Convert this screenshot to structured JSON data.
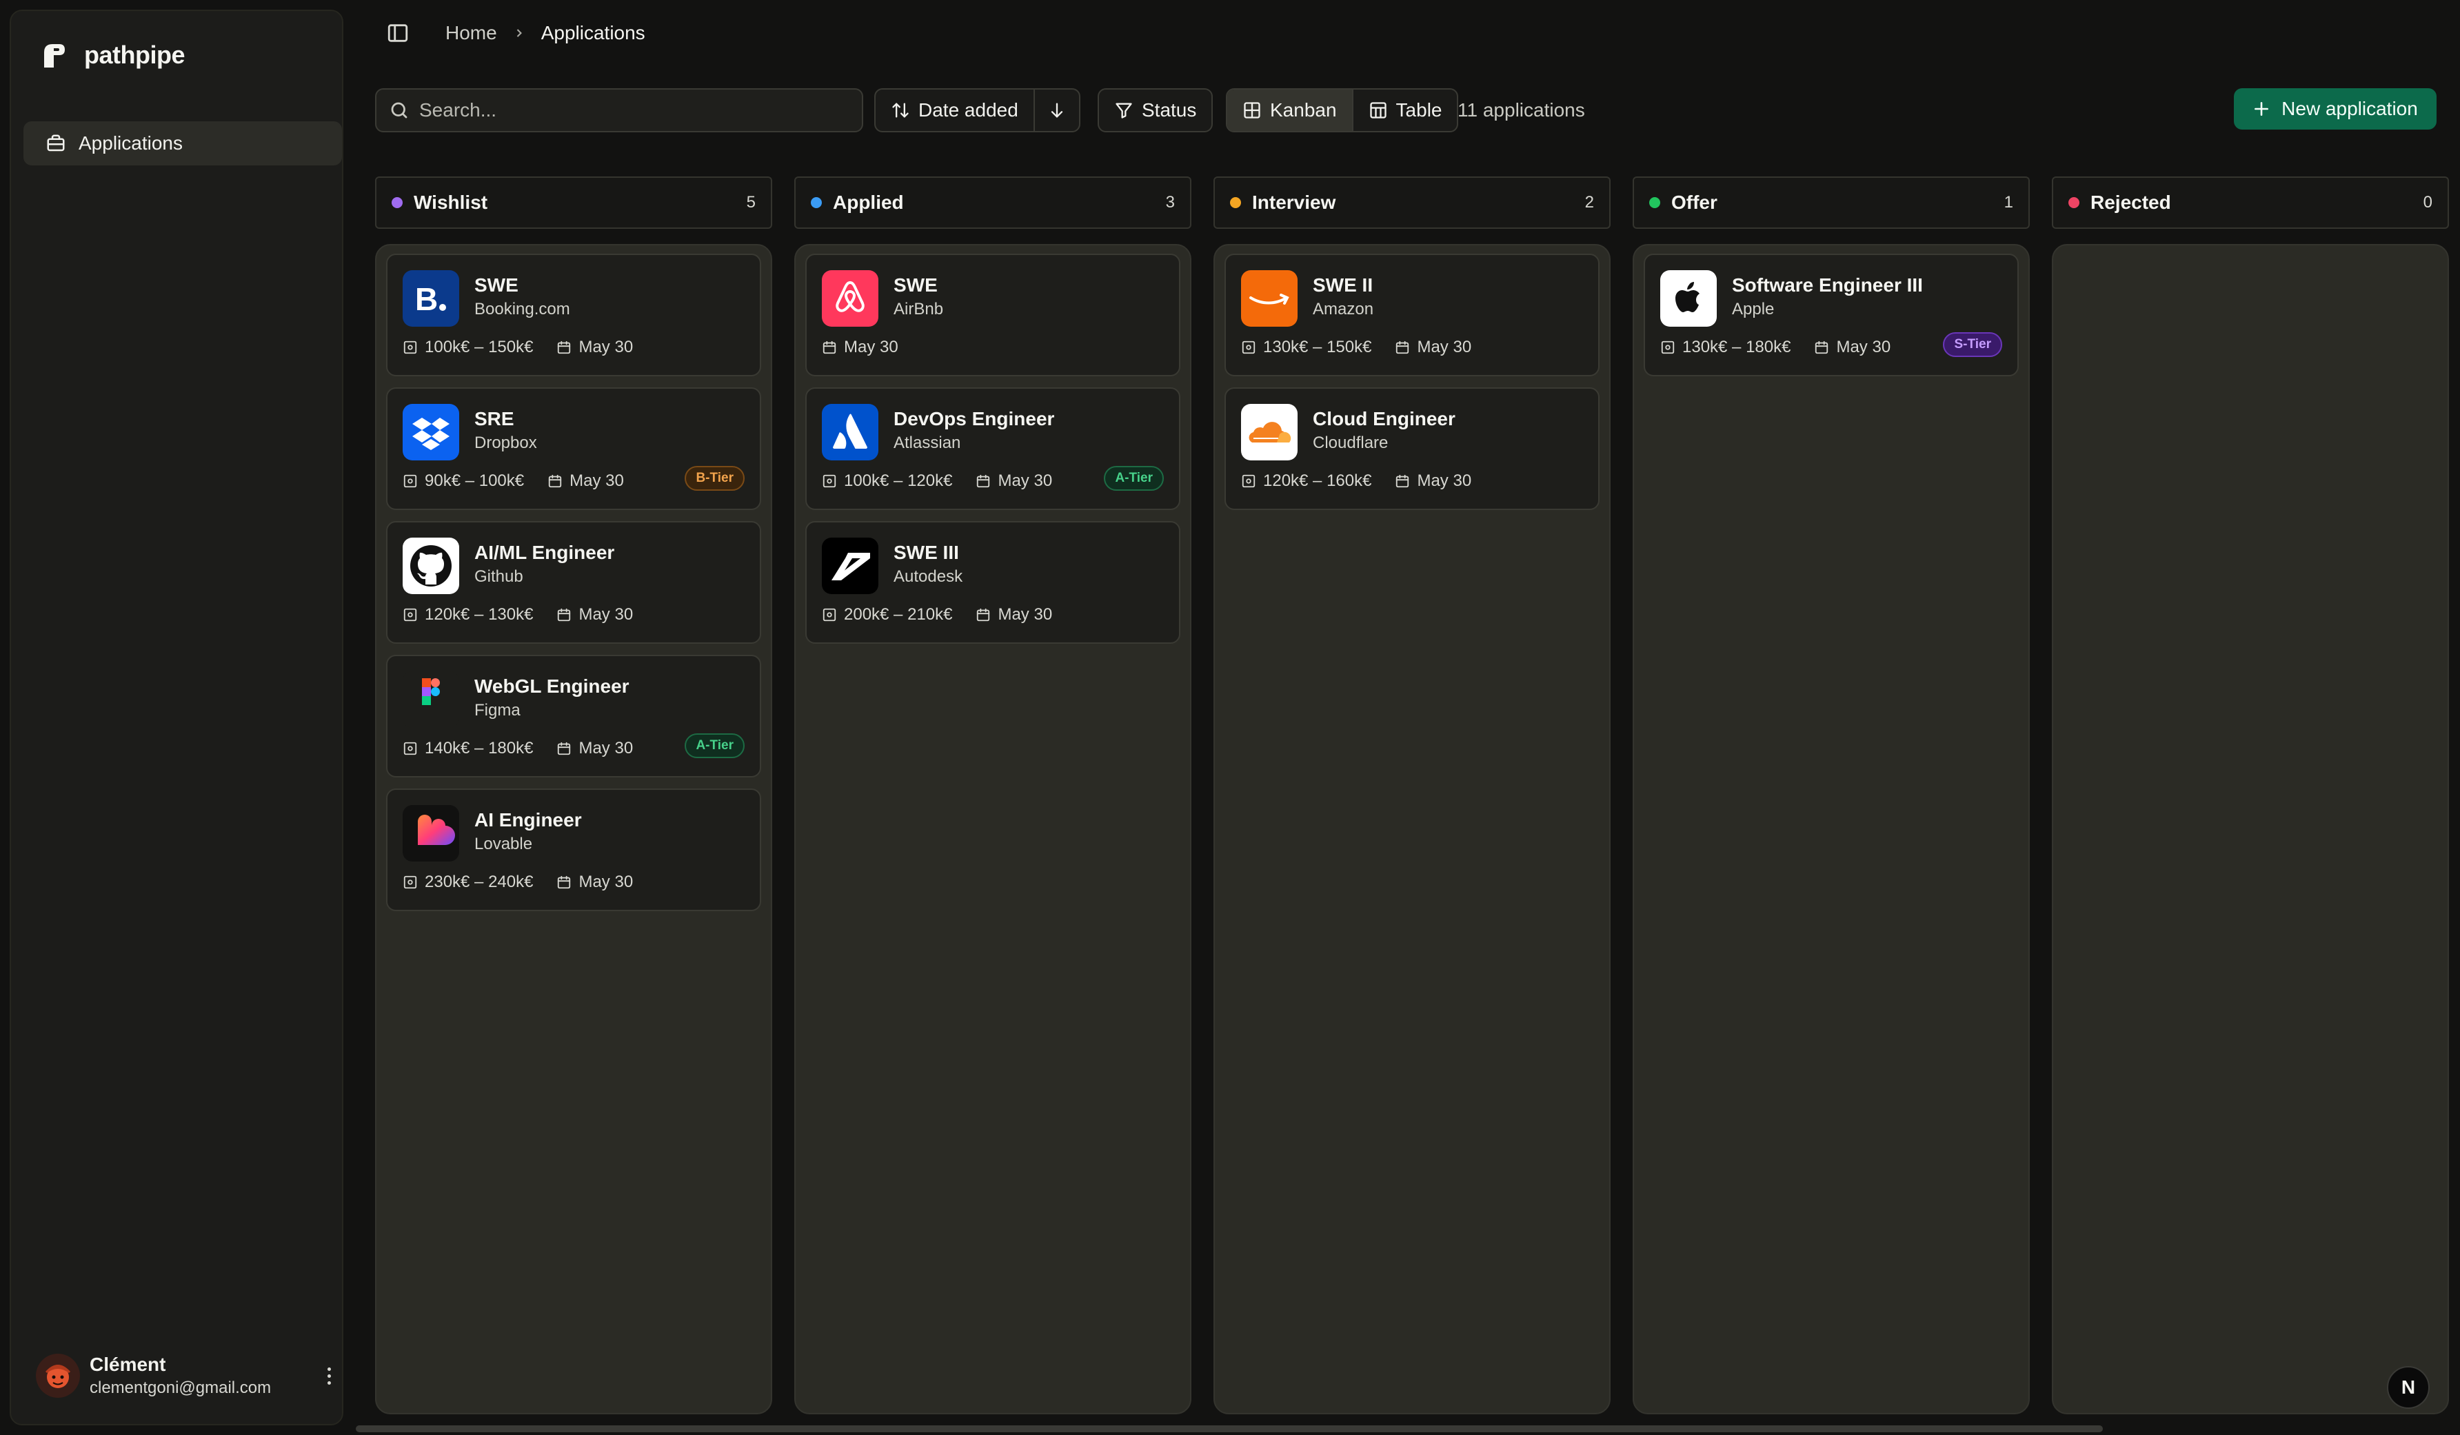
{
  "app": {
    "name": "pathpipe"
  },
  "sidebar": {
    "nav": [
      {
        "label": "Applications",
        "icon": "briefcase-icon"
      }
    ],
    "user": {
      "name": "Clément",
      "email": "clementgoni@gmail.com"
    }
  },
  "breadcrumb": {
    "home": "Home",
    "current": "Applications"
  },
  "toolbar": {
    "search_placeholder": "Search...",
    "sort_label": "Date added",
    "status_label": "Status",
    "view_kanban": "Kanban",
    "view_table": "Table",
    "count_text": "11 applications",
    "new_button": "New application",
    "accent": "#0c6a4b"
  },
  "columns": [
    {
      "title": "Wishlist",
      "count": "5",
      "color": "#a06cf0",
      "cards": [
        {
          "title": "SWE",
          "company": "Booking.com",
          "salary": "100k€ – 150k€",
          "date": "May 30",
          "tier": "",
          "logo": "booking"
        },
        {
          "title": "SRE",
          "company": "Dropbox",
          "salary": "90k€ – 100k€",
          "date": "May 30",
          "tier": "B-Tier",
          "tier_class": "b",
          "logo": "dropbox"
        },
        {
          "title": "AI/ML Engineer",
          "company": "Github",
          "salary": "120k€ – 130k€",
          "date": "May 30",
          "tier": "",
          "logo": "github"
        },
        {
          "title": "WebGL Engineer",
          "company": "Figma",
          "salary": "140k€ – 180k€",
          "date": "May 30",
          "tier": "A-Tier",
          "tier_class": "a",
          "logo": "figma"
        },
        {
          "title": "AI Engineer",
          "company": "Lovable",
          "salary": "230k€ – 240k€",
          "date": "May 30",
          "tier": "",
          "logo": "lovable"
        }
      ]
    },
    {
      "title": "Applied",
      "count": "3",
      "color": "#3b9cf5",
      "cards": [
        {
          "title": "SWE",
          "company": "AirBnb",
          "salary": "",
          "date": "May 30",
          "tier": "",
          "logo": "airbnb"
        },
        {
          "title": "DevOps Engineer",
          "company": "Atlassian",
          "salary": "100k€ – 120k€",
          "date": "May 30",
          "tier": "A-Tier",
          "tier_class": "a",
          "logo": "atlassian"
        },
        {
          "title": "SWE III",
          "company": "Autodesk",
          "salary": "200k€ – 210k€",
          "date": "May 30",
          "tier": "",
          "logo": "autodesk"
        }
      ]
    },
    {
      "title": "Interview",
      "count": "2",
      "color": "#f5a623",
      "cards": [
        {
          "title": "SWE II",
          "company": "Amazon",
          "salary": "130k€ – 150k€",
          "date": "May 30",
          "tier": "",
          "logo": "amazon"
        },
        {
          "title": "Cloud Engineer",
          "company": "Cloudflare",
          "salary": "120k€ – 160k€",
          "date": "May 30",
          "tier": "",
          "logo": "cloudflare"
        }
      ]
    },
    {
      "title": "Offer",
      "count": "1",
      "color": "#22c55e",
      "cards": [
        {
          "title": "Software Engineer III",
          "company": "Apple",
          "salary": "130k€ – 180k€",
          "date": "May 30",
          "tier": "S-Tier",
          "tier_class": "s",
          "logo": "apple"
        }
      ]
    },
    {
      "title": "Rejected",
      "count": "0",
      "color": "#ef4464",
      "cards": []
    }
  ],
  "next_badge": "N"
}
